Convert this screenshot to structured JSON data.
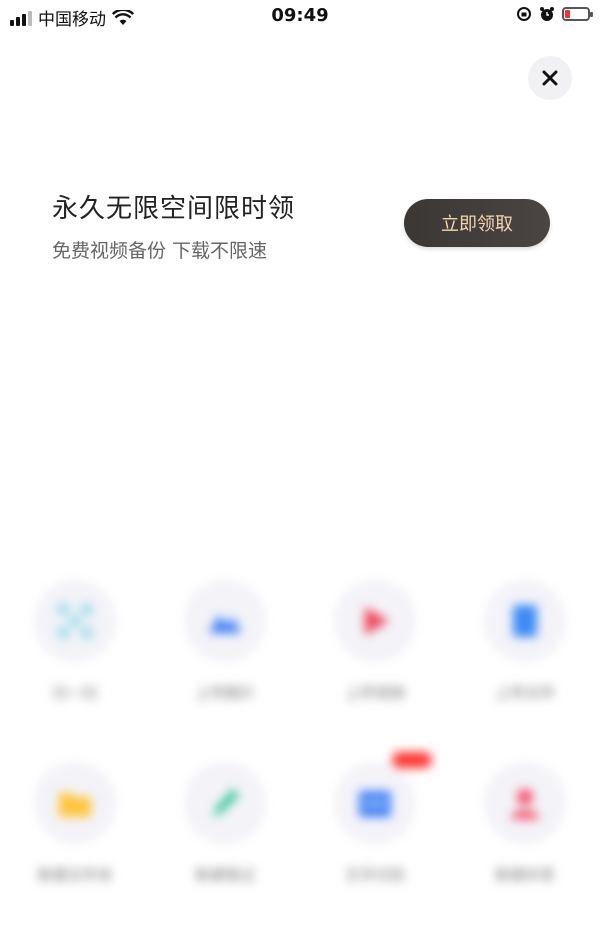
{
  "status_bar": {
    "carrier": "中国移动",
    "time": "09:49"
  },
  "dialog": {
    "title": "永久无限空间限时领",
    "subtitle": "免费视频备份 下载不限速",
    "claim_button": "立即领取"
  },
  "quick_actions": {
    "items": [
      {
        "label": "扫一扫",
        "icon": "scan-icon",
        "color": "#7fd3e6"
      },
      {
        "label": "上传图片",
        "icon": "image-upload-icon",
        "color": "#3f7ef5"
      },
      {
        "label": "上传视频",
        "icon": "video-upload-icon",
        "color": "#f0475c"
      },
      {
        "label": "上传文件",
        "icon": "file-upload-icon",
        "color": "#3d8bf5"
      },
      {
        "label": "新建文件夹",
        "icon": "folder-icon",
        "color": "#ffc53d"
      },
      {
        "label": "新建笔记",
        "icon": "note-icon",
        "color": "#2bc18c"
      },
      {
        "label": "文字识别",
        "icon": "text-recognition-icon",
        "color": "#3d7ff5"
      },
      {
        "label": "新建共享",
        "icon": "share-icon",
        "color": "#f5506b"
      }
    ]
  },
  "colors": {
    "claim_button_bg": "#3b3735",
    "claim_button_text": "#f3d6ac"
  }
}
